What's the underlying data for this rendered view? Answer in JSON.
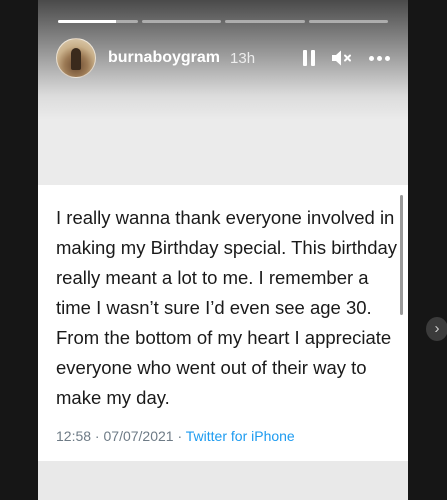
{
  "story": {
    "progress": [
      0.73,
      0,
      0,
      0
    ],
    "username": "burnaboygram",
    "time_ago": "13h",
    "controls": {
      "pause_icon": "pause-icon",
      "mute_icon": "muted-speaker-icon",
      "more_icon": "more-options-icon"
    }
  },
  "tweet": {
    "text": "I really wanna thank everyone involved in making my Birthday special. This birthday really meant a lot to me. I remember a time I wasn’t sure I’d even see age 30. From the bottom of my heart I appreciate everyone who went out of their way to make my day.",
    "time": "12:58",
    "separator": " · ",
    "date": "07/07/2021",
    "source": "Twitter for iPhone"
  },
  "navigation": {
    "next_glyph": "›"
  },
  "colors": {
    "link": "#1d9bf0",
    "meta": "#6e7b86",
    "background": "#161616"
  }
}
